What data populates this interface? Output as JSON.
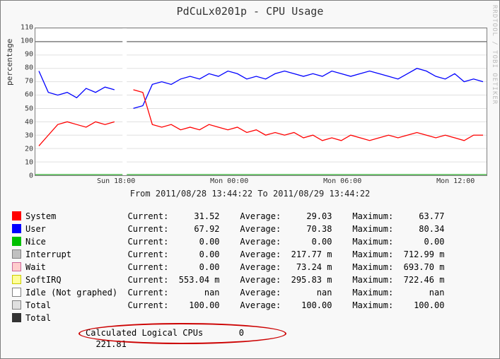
{
  "title": "PdCuLx0201p - CPU Usage",
  "watermark": "RRDTOOL / TOBI OETIKER",
  "ylabel": "percentage",
  "time_range": "From 2011/08/28 13:44:22 To 2011/08/29 13:44:22",
  "footer": {
    "label": "Calculated Logical CPUs",
    "value": "0",
    "extra": "221.81"
  },
  "stats_headers": {
    "cur": "Current:",
    "avg": "Average:",
    "max": "Maximum:"
  },
  "legend": [
    {
      "name": "System",
      "color": "#ff0000",
      "fill": "#ff0000",
      "cur": "31.52",
      "avg": "29.03",
      "max": "63.77"
    },
    {
      "name": "User",
      "color": "#0000ff",
      "fill": "#0000ff",
      "cur": "67.92",
      "avg": "70.38",
      "max": "80.34"
    },
    {
      "name": "Nice",
      "color": "#00c000",
      "fill": "#00c000",
      "cur": "0.00",
      "avg": "0.00",
      "max": "0.00"
    },
    {
      "name": "Interrupt",
      "color": "#808080",
      "fill": "#c0c0c0",
      "cur": "0.00",
      "avg": "217.77 m",
      "max": "712.99 m"
    },
    {
      "name": "Wait",
      "color": "#cc6699",
      "fill": "#ffcccc",
      "cur": "0.00",
      "avg": "73.24 m",
      "max": "693.70 m"
    },
    {
      "name": "SoftIRQ",
      "color": "#cccc00",
      "fill": "#ffff99",
      "cur": "553.04 m",
      "avg": "295.83 m",
      "max": "722.46 m"
    },
    {
      "name": "Idle (Not graphed)",
      "color": "#808080",
      "fill": "#ffffff",
      "cur": "nan",
      "avg": "nan",
      "max": "nan"
    },
    {
      "name": "Total",
      "color": "#808080",
      "fill": "#e0e0e0",
      "cur": "100.00",
      "avg": "100.00",
      "max": "100.00"
    },
    {
      "name": "Total",
      "color": "#333333",
      "fill": "#333333",
      "cur": "",
      "avg": "",
      "max": ""
    }
  ],
  "chart_data": {
    "type": "line",
    "xlabel": "",
    "ylabel": "percentage",
    "ylim": [
      0,
      110
    ],
    "x_ticks": [
      "Sun 18:00",
      "Mon 00:00",
      "Mon 06:00",
      "Mon 12:00"
    ],
    "y_ticks": [
      0,
      10,
      20,
      30,
      40,
      50,
      60,
      70,
      80,
      90,
      100,
      110
    ],
    "hrule": 100,
    "x": [
      0,
      1,
      2,
      3,
      4,
      5,
      6,
      7,
      8,
      9,
      10,
      11,
      12,
      13,
      14,
      15,
      16,
      17,
      18,
      19,
      20,
      21,
      22,
      23,
      24,
      25,
      26,
      27,
      28,
      29,
      30,
      31,
      32,
      33,
      34,
      35,
      36,
      37,
      38,
      39,
      40,
      41,
      42,
      43,
      44,
      45,
      46,
      47
    ],
    "series": [
      {
        "name": "User",
        "color": "#0000ff",
        "values": [
          78,
          62,
          60,
          62,
          58,
          65,
          62,
          66,
          64,
          null,
          50,
          52,
          68,
          70,
          68,
          72,
          74,
          72,
          76,
          74,
          78,
          76,
          72,
          74,
          72,
          76,
          78,
          76,
          74,
          76,
          74,
          78,
          76,
          74,
          76,
          78,
          76,
          74,
          72,
          76,
          80,
          78,
          74,
          72,
          76,
          70,
          72,
          70
        ]
      },
      {
        "name": "System",
        "color": "#ff0000",
        "values": [
          22,
          30,
          38,
          40,
          38,
          36,
          40,
          38,
          40,
          null,
          64,
          62,
          38,
          36,
          38,
          34,
          36,
          34,
          38,
          36,
          34,
          36,
          32,
          34,
          30,
          32,
          30,
          32,
          28,
          30,
          26,
          28,
          26,
          30,
          28,
          26,
          28,
          30,
          28,
          30,
          32,
          30,
          28,
          30,
          28,
          26,
          30,
          30
        ]
      }
    ]
  }
}
